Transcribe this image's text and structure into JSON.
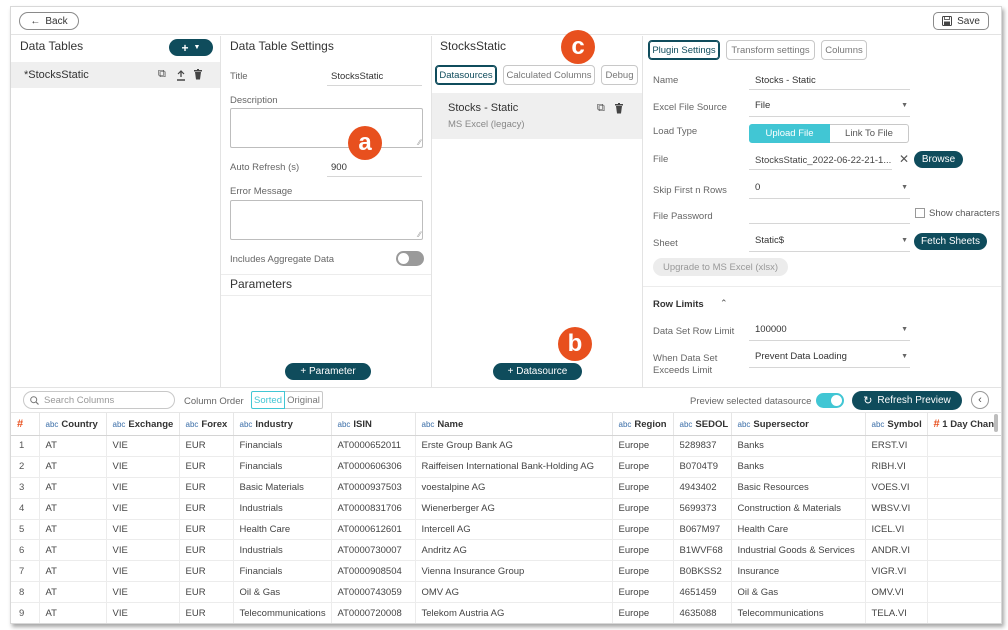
{
  "topbar": {
    "back_label": "Back",
    "save_label": "Save"
  },
  "data_tables": {
    "title": "Data Tables",
    "add_label": "+",
    "item_label": "*StocksStatic"
  },
  "settings": {
    "title": "Data Table Settings",
    "title_label": "Title",
    "title_value": "StocksStatic",
    "description_label": "Description",
    "auto_refresh_label": "Auto Refresh (s)",
    "auto_refresh_value": "900",
    "error_message_label": "Error Message",
    "includes_aggregate_label": "Includes Aggregate Data",
    "parameters_title": "Parameters",
    "add_parameter_label": "+ Parameter"
  },
  "datasources": {
    "title": "StocksStatic",
    "tabs": [
      "Datasources",
      "Calculated Columns",
      "Debug"
    ],
    "item_name": "Stocks - Static",
    "item_subtitle": "MS Excel (legacy)",
    "add_datasource_label": "+ Datasource"
  },
  "badges": {
    "a": "a",
    "b": "b",
    "c": "c"
  },
  "plugin": {
    "tabs": [
      "Plugin Settings",
      "Transform settings",
      "Columns"
    ],
    "name_label": "Name",
    "name_value": "Stocks - Static",
    "excel_source_label": "Excel File Source",
    "excel_source_value": "File",
    "load_type_label": "Load Type",
    "load_type_options": [
      "Upload File",
      "Link To File"
    ],
    "file_label": "File",
    "file_value": "StocksStatic_2022-06-22-21-1...",
    "browse_label": "Browse",
    "skip_label": "Skip First n Rows",
    "skip_value": "0",
    "password_label": "File Password",
    "show_chars_label": "Show characters",
    "sheet_label": "Sheet",
    "sheet_value": "Static$",
    "fetch_label": "Fetch Sheets",
    "upgrade_label": "Upgrade to MS Excel (xlsx)",
    "row_limits_label": "Row Limits",
    "row_limit_label": "Data Set Row Limit",
    "row_limit_value": "100000",
    "exceeds_label_1": "When Data Set",
    "exceeds_label_2": "Exceeds Limit",
    "exceeds_value": "Prevent Data Loading"
  },
  "grid_toolbar": {
    "search_placeholder": "Search Columns",
    "column_order_label": "Column Order",
    "sorted_label": "Sorted",
    "original_label": "Original",
    "preview_label": "Preview selected datasource",
    "refresh_label": "Refresh Preview"
  },
  "grid": {
    "hash": "#",
    "type_abc": "abc",
    "headers": [
      "Country",
      "Exchange",
      "Forex",
      "Industry",
      "ISIN",
      "Name",
      "Region",
      "SEDOL",
      "Supersector",
      "Symbol",
      "1 Day Chan"
    ],
    "rows": [
      [
        "1",
        "AT",
        "VIE",
        "EUR",
        "Financials",
        "AT0000652011",
        "Erste Group Bank AG",
        "Europe",
        "5289837",
        "Banks",
        "ERST.VI",
        ""
      ],
      [
        "2",
        "AT",
        "VIE",
        "EUR",
        "Financials",
        "AT0000606306",
        "Raiffeisen International Bank-Holding AG",
        "Europe",
        "B0704T9",
        "Banks",
        "RIBH.VI",
        ""
      ],
      [
        "3",
        "AT",
        "VIE",
        "EUR",
        "Basic Materials",
        "AT0000937503",
        "voestalpine AG",
        "Europe",
        "4943402",
        "Basic Resources",
        "VOES.VI",
        ""
      ],
      [
        "4",
        "AT",
        "VIE",
        "EUR",
        "Industrials",
        "AT0000831706",
        "Wienerberger AG",
        "Europe",
        "5699373",
        "Construction & Materials",
        "WBSV.VI",
        ""
      ],
      [
        "5",
        "AT",
        "VIE",
        "EUR",
        "Health Care",
        "AT0000612601",
        "Intercell AG",
        "Europe",
        "B067M97",
        "Health Care",
        "ICEL.VI",
        ""
      ],
      [
        "6",
        "AT",
        "VIE",
        "EUR",
        "Industrials",
        "AT0000730007",
        "Andritz AG",
        "Europe",
        "B1WVF68",
        "Industrial Goods & Services",
        "ANDR.VI",
        ""
      ],
      [
        "7",
        "AT",
        "VIE",
        "EUR",
        "Financials",
        "AT0000908504",
        "Vienna Insurance Group",
        "Europe",
        "B0BKSS2",
        "Insurance",
        "VIGR.VI",
        ""
      ],
      [
        "8",
        "AT",
        "VIE",
        "EUR",
        "Oil & Gas",
        "AT0000743059",
        "OMV AG",
        "Europe",
        "4651459",
        "Oil & Gas",
        "OMV.VI",
        ""
      ],
      [
        "9",
        "AT",
        "VIE",
        "EUR",
        "Telecommunications",
        "AT0000720008",
        "Telekom Austria AG",
        "Europe",
        "4635088",
        "Telecommunications",
        "TELA.VI",
        ""
      ]
    ]
  },
  "colors": {
    "accent_dark": "#0f4c5c",
    "accent_light": "#41c6d4",
    "badge": "#e8501e",
    "toggle_off": "#9a9a9a"
  }
}
